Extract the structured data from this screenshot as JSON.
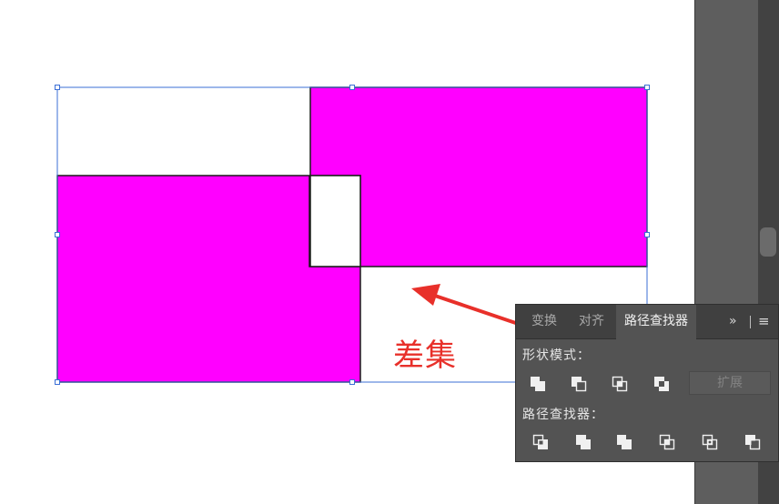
{
  "annotation": {
    "text": "差集",
    "color": "#e8302a"
  },
  "canvas": {
    "fill_color": "#ff00ff",
    "selection_color": "#3b6fd6",
    "stroke_color": "#1a1a1a"
  },
  "pathfinder_panel": {
    "tabs": [
      {
        "label": "变换",
        "active": false
      },
      {
        "label": "对齐",
        "active": false
      },
      {
        "label": "路径查找器",
        "active": true
      }
    ],
    "more_label": "»",
    "menu_label": "≡",
    "shape_modes_label": "形状模式：",
    "shape_modes": [
      "unite-icon",
      "minus-front-icon",
      "intersect-icon",
      "exclude-icon"
    ],
    "expand_label": "扩展",
    "pathfinders_label": "路径查找器：",
    "pathfinders": [
      "divide-icon",
      "trim-icon",
      "merge-icon",
      "crop-icon",
      "outline-icon",
      "minus-back-icon"
    ]
  }
}
